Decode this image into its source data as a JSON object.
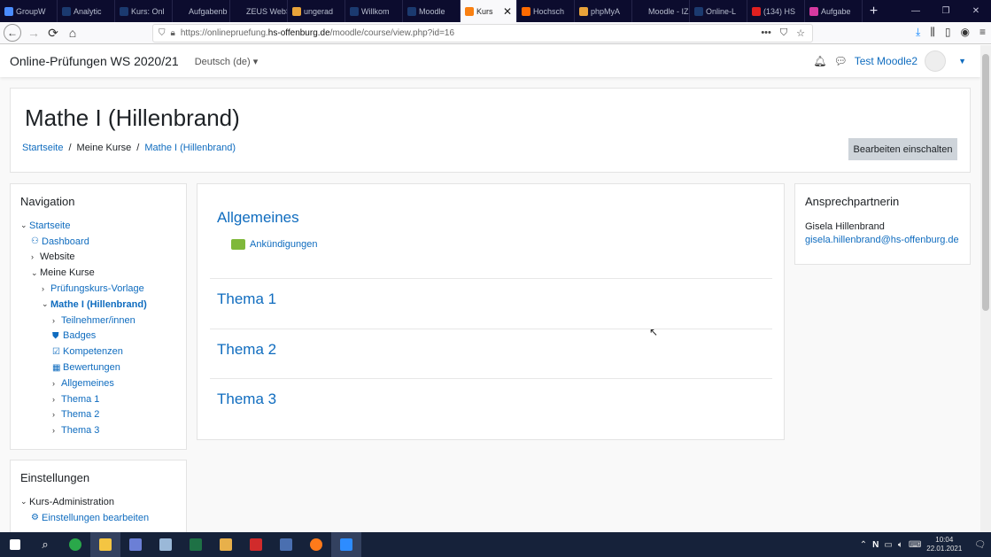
{
  "browser": {
    "tabs": [
      {
        "label": "GroupW",
        "color": "#4a8cff"
      },
      {
        "label": "Analytic",
        "color": "#1b3a6f"
      },
      {
        "label": "Kurs: Onl",
        "color": "#1b3a6f"
      },
      {
        "label": "Aufgabenb",
        "color": ""
      },
      {
        "label": "ZEUS WebSe",
        "color": ""
      },
      {
        "label": "ungerad",
        "color": "#e8a33a"
      },
      {
        "label": "Willkom",
        "color": "#1b3a6f"
      },
      {
        "label": "Moodle",
        "color": "#1b3a6f"
      },
      {
        "label": "Kurs",
        "color": "#f98012",
        "active": true
      },
      {
        "label": "Hochsch",
        "color": "#ff6a00"
      },
      {
        "label": "phpMyA",
        "color": "#e8a33a"
      },
      {
        "label": "Moodle - IZ",
        "color": ""
      },
      {
        "label": "Online-L",
        "color": "#1b3a6f"
      },
      {
        "label": "(134) HS",
        "color": "#e02020"
      },
      {
        "label": "Aufgabe",
        "color": "#d63aa0"
      }
    ],
    "close_glyph": "✕",
    "new_tab_glyph": "+",
    "url_prefix": "https://onlinepruefung.",
    "url_host": "hs-offenburg.de",
    "url_path": "/moodle/course/view.php?id=16"
  },
  "navbar": {
    "site_name": "Online-Prüfungen WS 2020/21",
    "language": "Deutsch (de)",
    "user_name": "Test Moodle2"
  },
  "header": {
    "course_title": "Mathe I (Hillenbrand)",
    "breadcrumb": [
      "Startseite",
      "Meine Kurse",
      "Mathe I (Hillenbrand)"
    ],
    "separator": "/",
    "edit_button": "Bearbeiten einschalten"
  },
  "navigation": {
    "title": "Navigation",
    "items": [
      {
        "label": "Startseite",
        "chev": "⌄",
        "ico": "",
        "style": "link"
      },
      {
        "label": "Dashboard",
        "chev": "",
        "ico": "⚇",
        "style": "link"
      },
      {
        "label": "Website",
        "chev": "›",
        "ico": "",
        "style": "plain"
      },
      {
        "label": "Meine Kurse",
        "chev": "⌄",
        "ico": "",
        "style": "plain"
      },
      {
        "label": "Prüfungskurs-Vorlage",
        "chev": "›",
        "ico": "",
        "style": "link"
      },
      {
        "label": "Mathe I (Hillenbrand)",
        "chev": "⌄",
        "ico": "",
        "style": "current"
      },
      {
        "label": "Teilnehmer/innen",
        "chev": "›",
        "ico": "",
        "style": "link"
      },
      {
        "label": "Badges",
        "chev": "",
        "ico": "⛊",
        "style": "link"
      },
      {
        "label": "Kompetenzen",
        "chev": "",
        "ico": "☑",
        "style": "link"
      },
      {
        "label": "Bewertungen",
        "chev": "",
        "ico": "▦",
        "style": "link"
      },
      {
        "label": "Allgemeines",
        "chev": "›",
        "ico": "",
        "style": "link"
      },
      {
        "label": "Thema 1",
        "chev": "›",
        "ico": "",
        "style": "link"
      },
      {
        "label": "Thema 2",
        "chev": "›",
        "ico": "",
        "style": "link"
      },
      {
        "label": "Thema 3",
        "chev": "›",
        "ico": "",
        "style": "link"
      }
    ]
  },
  "settings": {
    "title": "Einstellungen",
    "items": [
      {
        "label": "Kurs-Administration",
        "chev": "⌄",
        "ico": "",
        "style": "plain"
      },
      {
        "label": "Einstellungen bearbeiten",
        "chev": "",
        "ico": "⚙",
        "style": "link"
      }
    ]
  },
  "main": {
    "sections": [
      {
        "title": "Allgemeines"
      },
      {
        "title": "Thema 1"
      },
      {
        "title": "Thema 2"
      },
      {
        "title": "Thema 3"
      }
    ],
    "forum_link": "Ankündigungen"
  },
  "contact": {
    "title": "Ansprechpartnerin",
    "name": "Gisela Hillenbrand",
    "email": "gisela.hillenbrand@hs-offenburg.de"
  },
  "taskbar": {
    "time": "10:04",
    "date": "22.01.2021"
  }
}
